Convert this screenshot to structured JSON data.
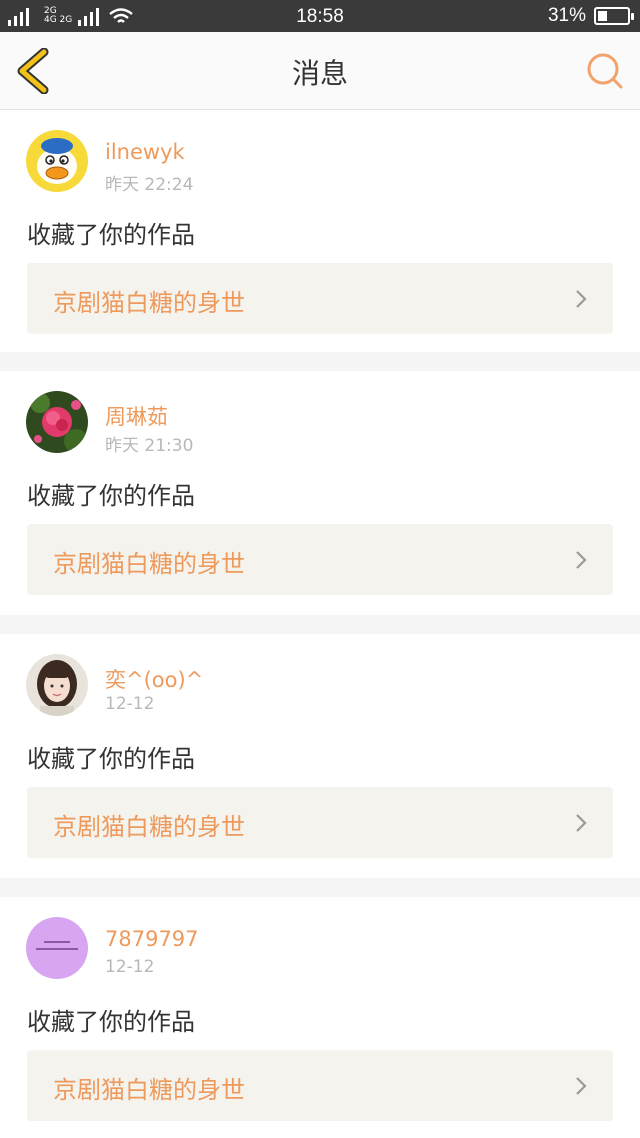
{
  "statusbar": {
    "net_top": "2G",
    "net_bottom": "4G 2G",
    "time": "18:58",
    "battery": "31%",
    "battery_level": 0.31
  },
  "header": {
    "title": "消息"
  },
  "colors": {
    "accent": "#ee9a5c",
    "back_icon": "#f2c21b",
    "search_icon": "#f2a26b"
  },
  "messages": [
    {
      "username": "ilnewyk",
      "time": "昨天 22:24",
      "action": "收藏了你的作品",
      "work_title": "京剧猫白糖的身世",
      "avatar": "duck-avatar"
    },
    {
      "username": "周琳茹",
      "time": "昨天 21:30",
      "action": "收藏了你的作品",
      "work_title": "京剧猫白糖的身世",
      "avatar": "flower-avatar"
    },
    {
      "username": "奕^(oo)^",
      "time": "12-12",
      "action": "收藏了你的作品",
      "work_title": "京剧猫白糖的身世",
      "avatar": "girl-avatar"
    },
    {
      "username": "7879797",
      "time": "12-12",
      "action": "收藏了你的作品",
      "work_title": "京剧猫白糖的身世",
      "avatar": "purple-avatar"
    }
  ]
}
